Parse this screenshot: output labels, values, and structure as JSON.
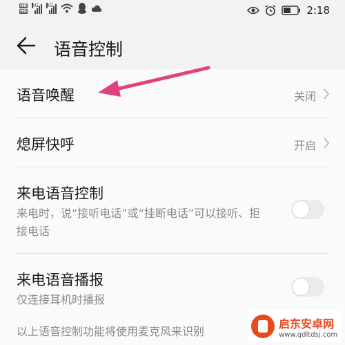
{
  "statusbar": {
    "hd1": "HD",
    "hd2": "HD",
    "net1": "4G",
    "net2": "4G",
    "time": "2:18"
  },
  "header": {
    "title": "语音控制"
  },
  "settings": [
    {
      "label": "语音唤醒",
      "value": "关闭"
    },
    {
      "label": "熄屏快呼",
      "value": "开启"
    },
    {
      "label": "来电语音控制",
      "sub": "来电时，说“接听电话”或“挂断电话”可以接听、拒接电话",
      "toggle_on": false
    },
    {
      "label": "来电语音播报",
      "sub": "仅连接耳机时播报",
      "toggle_on": false
    }
  ],
  "footnote": "以上语音控制功能将使用麦克风来识别",
  "watermark": {
    "name": "启东安卓网",
    "url": "www.qdltdsj.com"
  },
  "colors": {
    "annotation_arrow": "#e0407f",
    "watermark_brand": "#e8491d"
  }
}
